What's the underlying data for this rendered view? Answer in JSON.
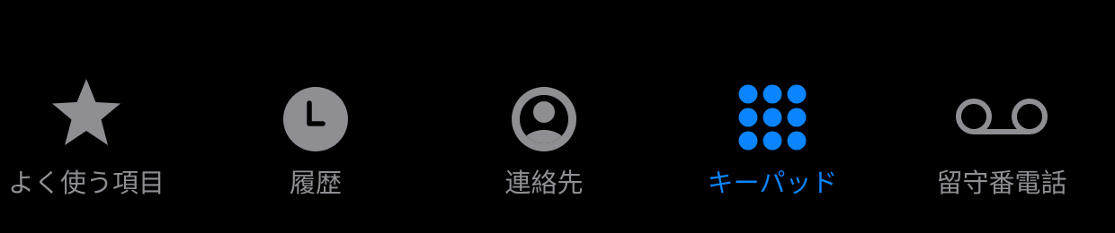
{
  "tabbar": {
    "active_tab": "keypad",
    "colors": {
      "background": "#000000",
      "inactive": "#8e8e93",
      "active": "#0a84ff"
    },
    "tabs": [
      {
        "id": "favorites",
        "label": "よく使う項目",
        "icon": "star-icon"
      },
      {
        "id": "recents",
        "label": "履歴",
        "icon": "clock-icon"
      },
      {
        "id": "contacts",
        "label": "連絡先",
        "icon": "person-circle-icon"
      },
      {
        "id": "keypad",
        "label": "キーパッド",
        "icon": "keypad-grid-icon"
      },
      {
        "id": "voicemail",
        "label": "留守番電話",
        "icon": "voicemail-icon"
      }
    ]
  }
}
